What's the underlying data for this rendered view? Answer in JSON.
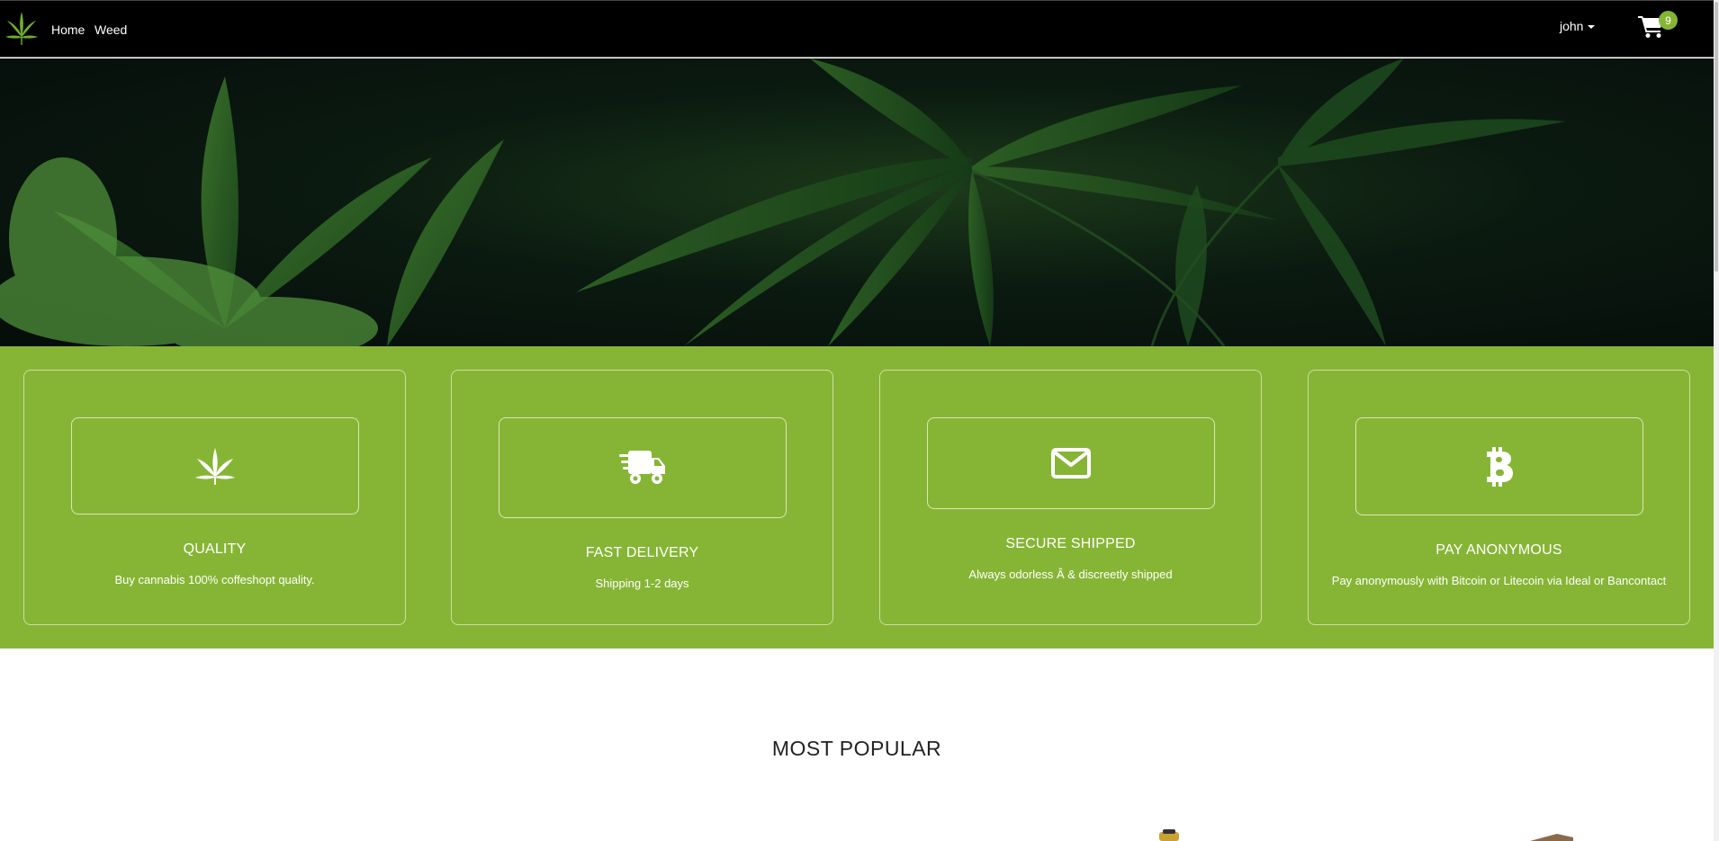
{
  "nav": {
    "links": [
      {
        "label": "Home"
      },
      {
        "label": "Weed"
      }
    ],
    "user": "john",
    "cart_count": "9",
    "brand_icon": "cannabis-leaf-icon"
  },
  "features": [
    {
      "icon": "cannabis-leaf-icon",
      "title": "QUALITY",
      "text": "Buy cannabis 100% coffeshopt quality."
    },
    {
      "icon": "shipping-truck-icon",
      "title": "FAST DELIVERY",
      "text": "Shipping 1-2 days"
    },
    {
      "icon": "envelope-icon",
      "title": "SECURE SHIPPED",
      "text": "Always odorless Â & discreetly shipped"
    },
    {
      "icon": "bitcoin-icon",
      "title": "PAY ANONYMOUS",
      "text": "Pay anonymously with Bitcoin or Litecoin via Ideal or Bancontact"
    }
  ],
  "popular": {
    "title": "MOST POPULAR"
  },
  "colors": {
    "navbar": "#000000",
    "accent_green": "#86b535",
    "text_dark": "#222222"
  }
}
